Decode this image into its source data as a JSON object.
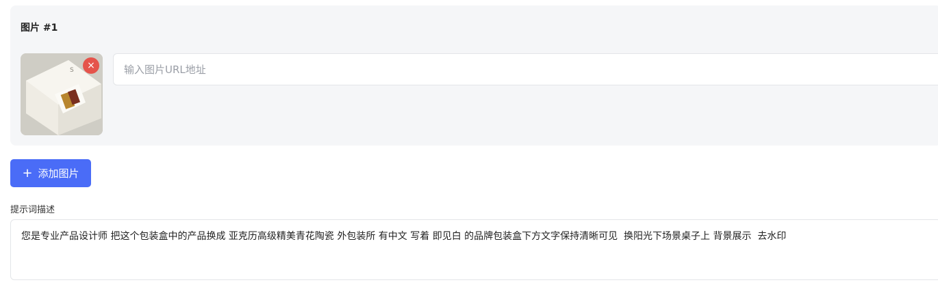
{
  "images": {
    "card_title": "图片 #1",
    "remove_symbol": "×",
    "url_placeholder": "输入图片URL地址",
    "url_value": "",
    "thumbnail_description_icon": "image-thumbnail",
    "remove_color": "#e5534b"
  },
  "add_button": {
    "plus": "+",
    "label": "添加图片",
    "color": "#4a6cf7"
  },
  "prompt": {
    "label": "提示词描述",
    "text": "您是专业产品设计师 把这个包装盒中的产品换成 亚克历高级精美青花陶瓷 外包装所 有中文 写着 即见白 的品牌包装盒下方文字保持清晰可见  换阳光下场景桌子上 背景展示  去水印"
  }
}
